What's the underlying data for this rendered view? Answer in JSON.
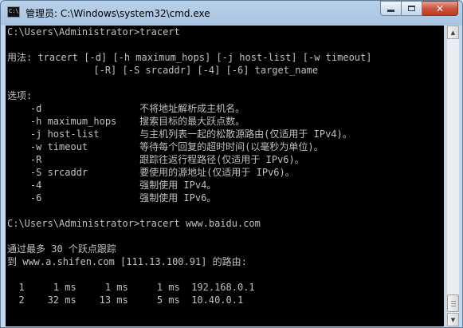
{
  "window": {
    "title": "管理员: C:\\Windows\\system32\\cmd.exe",
    "icon_text": "C:\\.",
    "controls": {
      "minimize": "minimize-icon",
      "maximize": "maximize-icon",
      "close": "✕"
    }
  },
  "console": {
    "lines": [
      "C:\\Users\\Administrator>tracert",
      "",
      "用法: tracert [-d] [-h maximum_hops] [-j host-list] [-w timeout]",
      "               [-R] [-S srcaddr] [-4] [-6] target_name",
      "",
      "选项:",
      "    -d                 不将地址解析成主机名。",
      "    -h maximum_hops    搜索目标的最大跃点数。",
      "    -j host-list       与主机列表一起的松散源路由(仅适用于 IPv4)。",
      "    -w timeout         等待每个回复的超时时间(以毫秒为单位)。",
      "    -R                 跟踪往返行程路径(仅适用于 IPv6)。",
      "    -S srcaddr         要使用的源地址(仅适用于 IPv6)。",
      "    -4                 强制使用 IPv4。",
      "    -6                 强制使用 IPv6。",
      "",
      "C:\\Users\\Administrator>tracert www.baidu.com",
      "",
      "通过最多 30 个跃点跟踪",
      "到 www.a.shifen.com [111.13.100.91] 的路由:",
      "",
      "  1     1 ms     1 ms     1 ms  192.168.0.1",
      "  2    32 ms    13 ms     5 ms  10.40.0.1"
    ]
  },
  "scrollbar": {
    "up_arrow": "▲",
    "down_arrow": "▼"
  },
  "colors": {
    "console_bg": "#000000",
    "console_fg": "#c0c0c0",
    "frame": "#b9d1ea",
    "close_button": "#c85540"
  }
}
